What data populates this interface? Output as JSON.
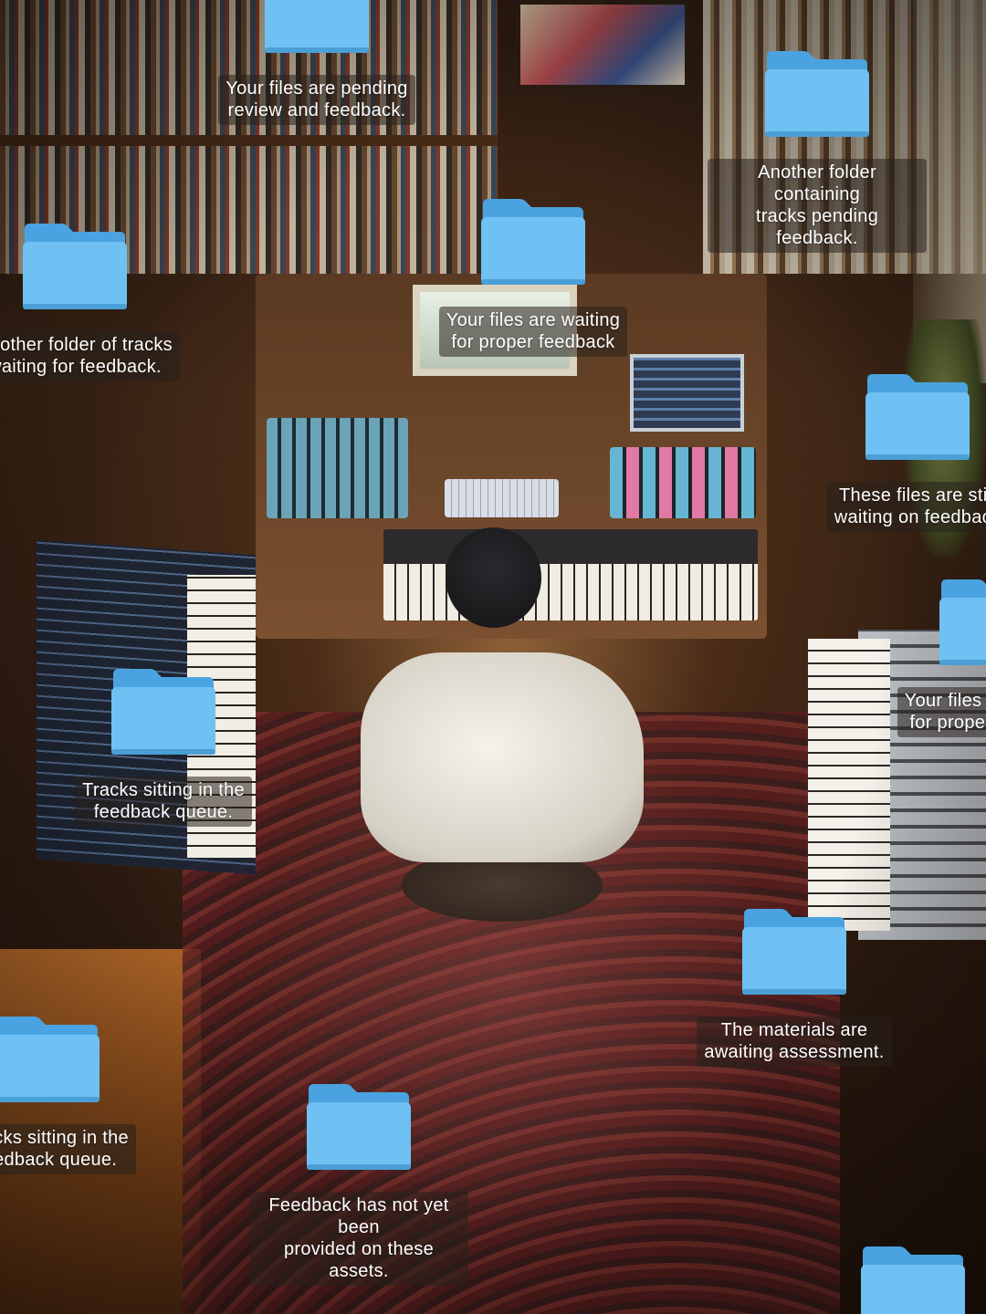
{
  "desktop": {
    "folders": [
      {
        "label": "Your files are pending\nreview and feedback.",
        "icon": "folder-icon"
      },
      {
        "label": "Another folder containing\ntracks pending feedback.",
        "icon": "folder-icon"
      },
      {
        "label": "Your files are waiting\nfor proper feedback",
        "icon": "folder-icon"
      },
      {
        "label": "Another folder of tracks\nwaiting for feedback.",
        "icon": "folder-icon"
      },
      {
        "label": "These files are still\nwaiting on feedback",
        "icon": "folder-icon"
      },
      {
        "label": "Your files are waiting\nfor proper feedback",
        "icon": "folder-icon"
      },
      {
        "label": "Tracks sitting in the\nfeedback queue.",
        "icon": "folder-icon"
      },
      {
        "label": "The materials are\nawaiting assessment.",
        "icon": "folder-icon"
      },
      {
        "label": "Tracks sitting in the\nfeedback queue.",
        "icon": "folder-icon"
      },
      {
        "label": "Feedback has not yet been\nprovided on these assets.",
        "icon": "folder-icon"
      },
      {
        "label": "",
        "icon": "folder-icon"
      }
    ],
    "colors": {
      "folder_front": "#6ec1f2",
      "folder_back": "#4aa3e0",
      "label_background": "rgba(40,32,28,0.55)"
    }
  }
}
